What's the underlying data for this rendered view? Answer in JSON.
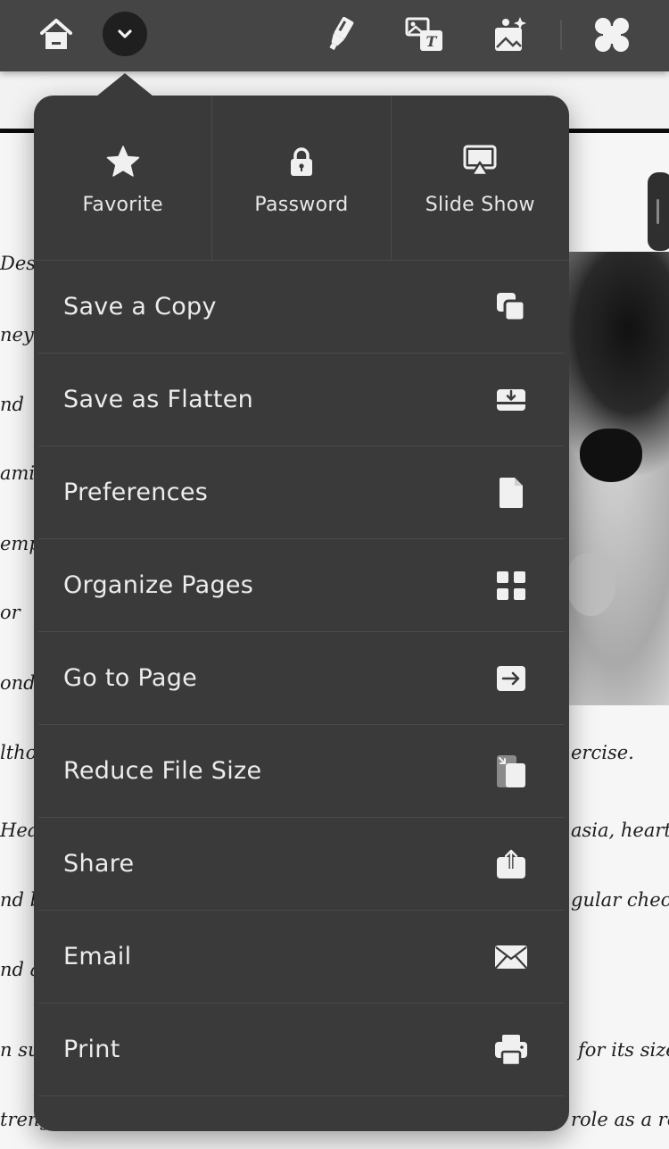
{
  "toolbar": {
    "icons": [
      "home-icon",
      "chevron-down-icon",
      "highlighter-icon",
      "image-text-icon",
      "ai-image-icon",
      "apps-grid-icon"
    ]
  },
  "popover": {
    "top_actions": [
      {
        "label": "Favorite",
        "icon": "star-icon"
      },
      {
        "label": "Password",
        "icon": "lock-icon"
      },
      {
        "label": "Slide Show",
        "icon": "slideshow-icon"
      }
    ],
    "items": [
      {
        "label": "Save a Copy",
        "icon": "copy-icon"
      },
      {
        "label": "Save as Flatten",
        "icon": "flatten-download-icon"
      },
      {
        "label": "Preferences",
        "icon": "document-icon"
      },
      {
        "label": "Organize Pages",
        "icon": "grid-icon"
      },
      {
        "label": "Go to Page",
        "icon": "arrow-right-box-icon"
      },
      {
        "label": "Reduce File Size",
        "icon": "reduce-size-icon"
      },
      {
        "label": "Share",
        "icon": "share-icon"
      },
      {
        "label": "Email",
        "icon": "mail-icon"
      },
      {
        "label": "Print",
        "icon": "printer-icon"
      }
    ]
  },
  "document": {
    "left_fragments": [
      "Desp",
      "ney t",
      "nd",
      "amili",
      "empe",
      "or",
      "ond",
      "ltho",
      "Heal",
      "nd b",
      "nd a",
      "n su",
      "treng"
    ],
    "right_fragments": [
      "ercise.",
      "asia, heart is",
      "gular check",
      "for its size",
      "role as a re"
    ]
  }
}
